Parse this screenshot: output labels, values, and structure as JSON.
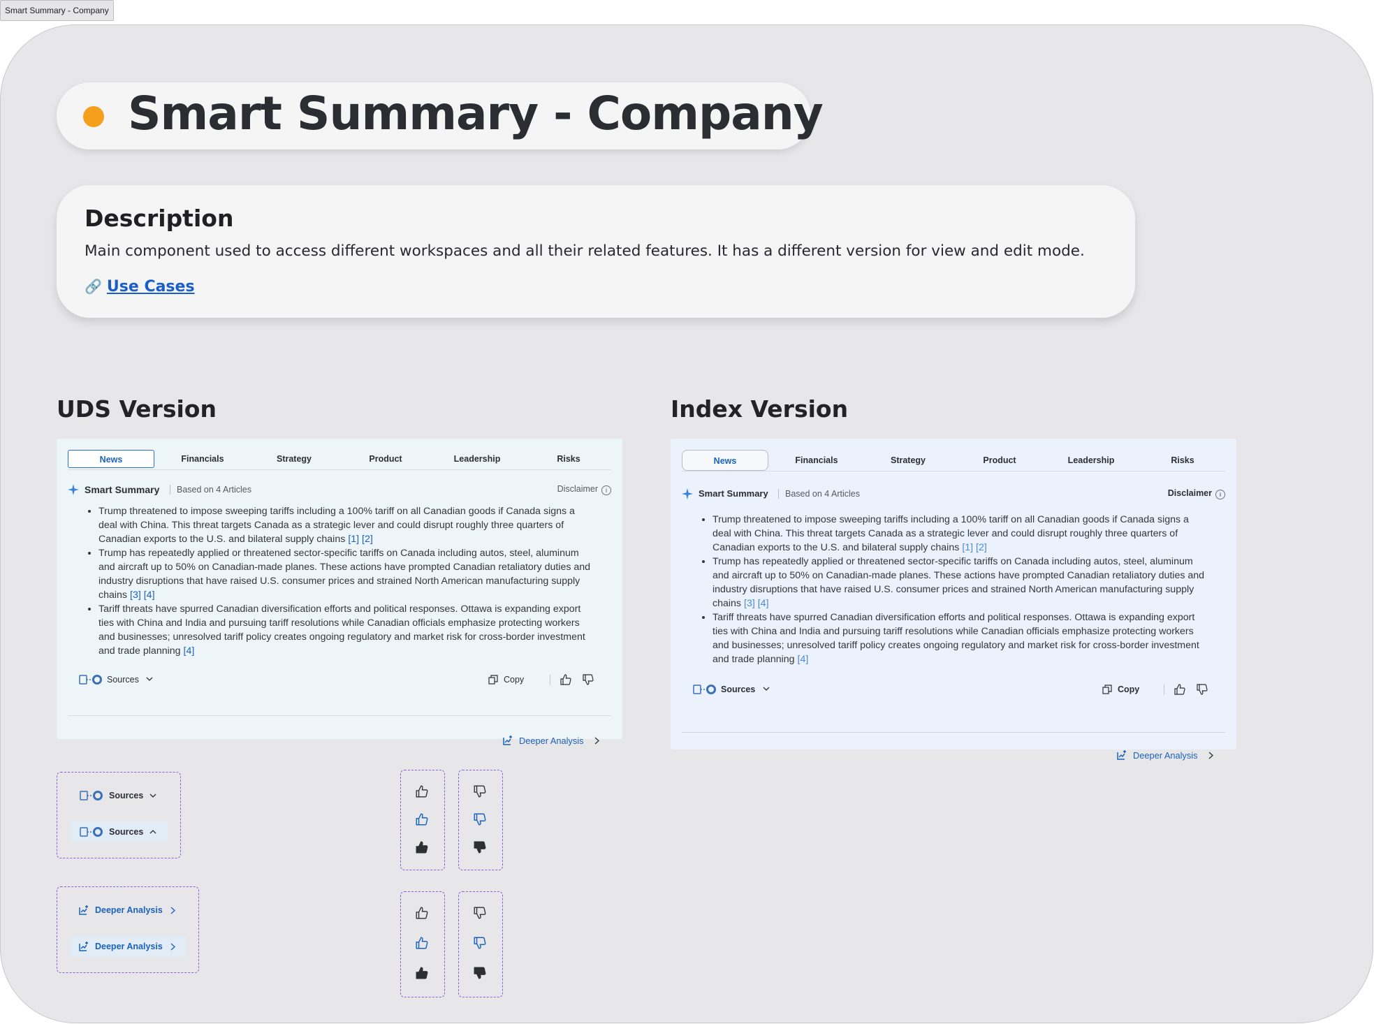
{
  "window": {
    "tab_title": "Smart Summary - Company"
  },
  "header": {
    "title": "Smart Summary - Company",
    "accent_color": "#f4a01c"
  },
  "description": {
    "heading": "Description",
    "body": "Main component used to access different workspaces and all their related features. It has a different version for view and edit mode.",
    "link_icon": "link-icon",
    "link_label": "Use Cases"
  },
  "uds": {
    "section_title": "UDS Version",
    "card": {
      "tabs": [
        "News",
        "Financials",
        "Strategy",
        "Product",
        "Leadership",
        "Risks"
      ],
      "active_tab": "News",
      "summary_title": "Smart Summary",
      "based_on": "Based on 4 Articles",
      "disclaimer": "Disclaimer",
      "bullets": [
        {
          "text": "Trump threatened to impose sweeping tariffs including a 100% tariff on all Canadian goods if Canada signs a deal with China. This threat targets Canada as a strategic lever and could disrupt roughly three quarters of Canadian exports to the U.S. and bilateral supply chains",
          "cites": "[1] [2]"
        },
        {
          "text": "Trump has repeatedly applied or threatened sector-specific tariffs on Canada including autos, steel, aluminum and aircraft up to 50% on Canadian-made planes. These actions have prompted Canadian retaliatory duties and industry disruptions that have raised U.S. consumer prices and strained North American manufacturing supply chains",
          "cites": "[3] [4]"
        },
        {
          "text": "Tariff threats have spurred Canadian diversification efforts and political responses. Ottawa is expanding export ties with China and India and pursuing tariff resolutions while Canadian officials emphasize protecting workers and businesses; unresolved tariff policy creates ongoing regulatory and market risk for cross-border investment and trade planning",
          "cites": "[4]"
        }
      ],
      "sources_label": "Sources",
      "copy_label": "Copy",
      "deeper_label": "Deeper Analysis"
    }
  },
  "index": {
    "section_title": "Index Version",
    "card": {
      "tabs": [
        "News",
        "Financials",
        "Strategy",
        "Product",
        "Leadership",
        "Risks"
      ],
      "active_tab": "News",
      "summary_title": "Smart Summary",
      "based_on": "Based on 4 Articles",
      "disclaimer": "Disclaimer",
      "bullets": [
        {
          "text": "Trump threatened to impose sweeping tariffs including a 100% tariff on all Canadian goods if Canada signs a deal with China. This threat targets Canada as a strategic lever and could disrupt roughly three quarters of Canadian exports to the U.S. and bilateral supply chains",
          "cites": "[1] [2]"
        },
        {
          "text": "Trump has repeatedly applied or threatened sector-specific tariffs on Canada including autos, steel, aluminum and aircraft up to 50% on Canadian-made planes. These actions have prompted Canadian retaliatory duties and industry disruptions that have raised U.S. consumer prices and strained North American manufacturing supply chains",
          "cites": "[3] [4]"
        },
        {
          "text": "Tariff threats have spurred Canadian diversification efforts and political responses. Ottawa is expanding export ties with China and India and pursuing tariff resolutions while Canadian officials emphasize protecting workers and businesses; unresolved tariff policy creates ongoing regulatory and market risk for cross-border investment and trade planning",
          "cites": "[4]"
        }
      ],
      "sources_label": "Sources",
      "copy_label": "Copy",
      "deeper_label": "Deeper Analysis"
    }
  },
  "variants": {
    "sources": [
      "Sources",
      "Sources"
    ],
    "deeper": [
      "Deeper Analysis",
      "Deeper Analysis"
    ],
    "icons": [
      "thumbs-up-icon",
      "thumbs-down-icon",
      "sources-icon",
      "copy-icon",
      "deeper-analysis-icon",
      "sparkle-icon",
      "info-icon",
      "chevron-down-icon",
      "chevron-up-icon",
      "chevron-right-icon"
    ],
    "colors": {
      "primary_blue": "#1a62bd",
      "dashed_border": "#8a5fe0",
      "uds_card_bg": "#eef5f9",
      "index_card_bg": "#ebf2fb"
    }
  }
}
